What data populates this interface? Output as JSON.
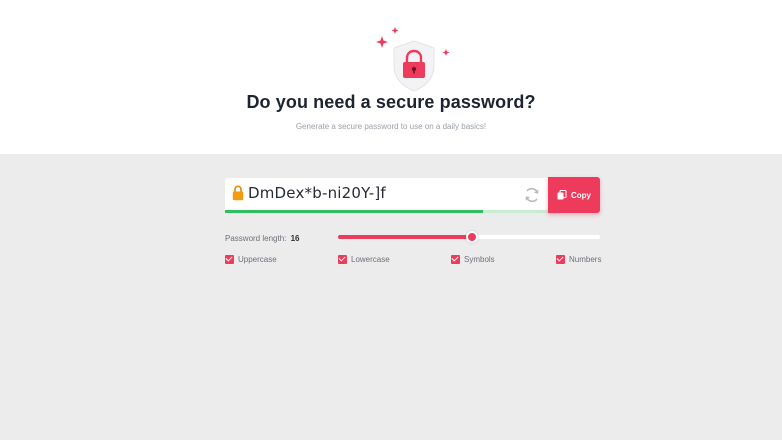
{
  "hero": {
    "title": "Do you need a secure password?",
    "subtitle": "Generate a secure password to use on a daily basics!",
    "icon": "shield-lock-icon"
  },
  "generator": {
    "password": "DmDex*b-ni20Y-]f",
    "strength": 0.8,
    "copy_label": "Copy",
    "length_label": "Password length:",
    "length_value": "16",
    "length_fraction": 0.51
  },
  "options": [
    {
      "label": "Uppercase",
      "checked": true
    },
    {
      "label": "Lowercase",
      "checked": true
    },
    {
      "label": "Symbols",
      "checked": true
    },
    {
      "label": "Numbers",
      "checked": true
    }
  ],
  "colors": {
    "accent": "#ee3b5b",
    "strength_good": "#2fbf5f",
    "background": "#ececec"
  }
}
